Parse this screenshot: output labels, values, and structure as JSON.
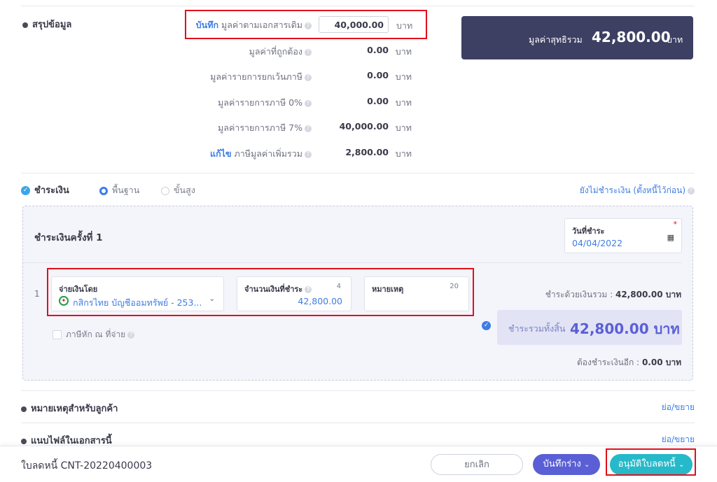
{
  "summary": {
    "section_title": "สรุปข้อมูล",
    "save_link": "บันทึก",
    "rows": [
      {
        "label": "มูลค่าตามเอกสารเดิม",
        "value": "40,000.00",
        "unit": "บาท"
      },
      {
        "label": "มูลค่าที่ถูกต้อง",
        "value": "0.00",
        "unit": "บาท"
      },
      {
        "label": "มูลค่ารายการยกเว้นภาษี",
        "value": "0.00",
        "unit": "บาท"
      },
      {
        "label": "มูลค่ารายการภาษี 0%",
        "value": "0.00",
        "unit": "บาท"
      },
      {
        "label": "มูลค่ารายการภาษี 7%",
        "value": "40,000.00",
        "unit": "บาท"
      },
      {
        "label": "ภาษีมูลค่าเพิ่มรวม",
        "value": "2,800.00",
        "unit": "บาท"
      }
    ],
    "edit_link": "แก้ไข",
    "net_total_label": "มูลค่าสุทธิรวม",
    "net_total_value": "42,800.00",
    "net_total_unit": "บาท"
  },
  "payment": {
    "section_title": "ชำระเงิน",
    "mode_basic": "พื้นฐาน",
    "mode_advanced": "ขั้นสูง",
    "unpaid_link": "ยังไม่ชำระเงิน (ตั้งหนี้ไว้ก่อน)",
    "installment_title": "ชำระเงินครั้งที่ 1",
    "date_label": "วันที่ชำระ",
    "date_value": "04/04/2022",
    "row_no": "1",
    "pay_by_label": "จ่ายเงินโดย",
    "pay_by_value": "กสิกรไทย บัญชีออมทรัพย์ - 253...",
    "amount_label": "จำนวนเงินที่ชำระ",
    "amount_counter": "4",
    "amount_value": "42,800.00",
    "note_label": "หมายเหตุ",
    "note_counter": "20",
    "wht_label": "ภาษีหัก ณ ที่จ่าย",
    "total_paid_label": "ชำระด้วยเงินรวม :",
    "total_paid_value": "42,800.00 บาท",
    "grand_label": "ชำระรวมทั้งสิ้น",
    "grand_value": "42,800.00 บาท",
    "remaining_label": "ต้องชำระเงินอีก :",
    "remaining_value": "0.00 บาท"
  },
  "notes": {
    "customer_notes_title": "หมายเหตุสำหรับลูกค้า",
    "attachments_title": "แนบไฟล์ในเอกสารนี้",
    "toggle_label": "ย่อ/ขยาย"
  },
  "footer": {
    "doc_label": "ใบลดหนี้ CNT-20220400003",
    "cancel": "ยกเลิก",
    "save_draft": "บันทึกร่าง",
    "approve": "อนุมัติใบลดหนี้"
  },
  "colors": {
    "accent": "#3d7de4",
    "net_box": "#3d3f63",
    "approve": "#26b9c9",
    "draft": "#5a5fd6",
    "highlight": "#e0101a"
  }
}
